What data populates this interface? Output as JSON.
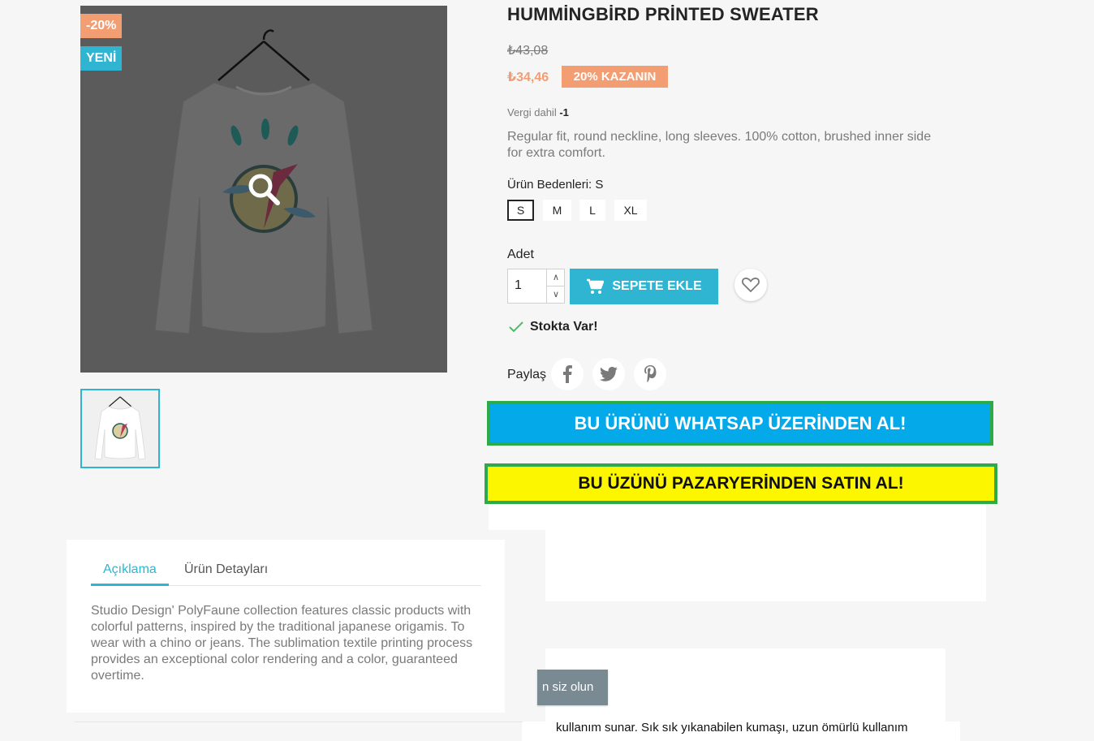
{
  "product": {
    "title": "HUMMİNGBİRD PRİNTED SWEATER",
    "flag_discount": "-20%",
    "flag_new": "YENİ",
    "old_price": "₺43,08",
    "price": "₺34,46",
    "save_badge": "20% KAZANIN",
    "tax_label": "Vergi dahil",
    "tax_value": "-1",
    "short_description": "Regular fit, round neckline, long sleeves. 100% cotton, brushed inner side for extra comfort."
  },
  "size": {
    "label": "Ürün Bedenleri: S",
    "options": [
      "S",
      "M",
      "L",
      "XL"
    ],
    "selected": "S"
  },
  "quantity": {
    "label": "Adet",
    "value": "1"
  },
  "cart": {
    "add_label": "SEPETE EKLE"
  },
  "stock": {
    "label": "Stokta Var!"
  },
  "share": {
    "label": "Paylaş"
  },
  "cta": {
    "whatsapp": "BU ÜRÜNÜ WHATSAP ÜZERİNDEN AL!",
    "marketplace": "BU ÜZÜNÜ PAZARYERİNDEN SATIN AL!"
  },
  "tabs": {
    "items": [
      "Açıklama",
      "Ürün Detayları"
    ],
    "active": "Açıklama",
    "description": "Studio Design' PolyFaune collection features classic products with colorful patterns, inspired by the traditional japanese origamis. To wear with a chino or jeans. The sublimation textile printing process provides an exceptional color rendering and a color, guaranteed overtime."
  },
  "overlay": {
    "notify_button": "n siz olun",
    "bottom_text": "kullanım sunar. Sık sık yıkanabilen kumaşı, uzun ömürlü kullanım"
  },
  "colors": {
    "accent": "#2fb5d2",
    "discount": "#f39d72",
    "whatsapp_bg": "#03a9e9",
    "market_bg": "#fdf601",
    "cta_border": "#2eaa47"
  }
}
